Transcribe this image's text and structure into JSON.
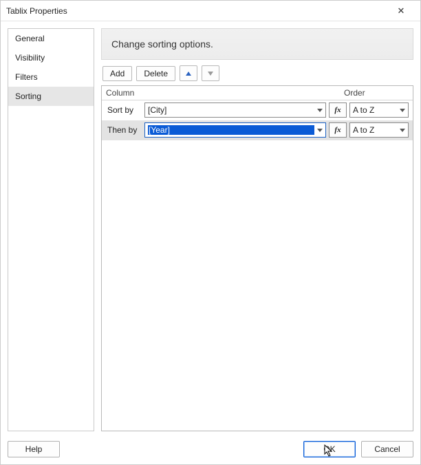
{
  "window": {
    "title": "Tablix Properties"
  },
  "sidebar": {
    "items": [
      {
        "label": "General",
        "selected": false
      },
      {
        "label": "Visibility",
        "selected": false
      },
      {
        "label": "Filters",
        "selected": false
      },
      {
        "label": "Sorting",
        "selected": true
      }
    ]
  },
  "header": {
    "title": "Change sorting options."
  },
  "toolbar": {
    "add_label": "Add",
    "delete_label": "Delete"
  },
  "grid": {
    "column_header": "Column",
    "order_header": "Order",
    "rows": [
      {
        "label": "Sort by",
        "value": "[City]",
        "order": "A to Z",
        "selected": false,
        "value_selected": false
      },
      {
        "label": "Then by",
        "value": "[Year]",
        "order": "A to Z",
        "selected": true,
        "value_selected": true
      }
    ],
    "fx_label": "fx"
  },
  "footer": {
    "help_label": "Help",
    "ok_label": "OK",
    "cancel_label": "Cancel"
  }
}
